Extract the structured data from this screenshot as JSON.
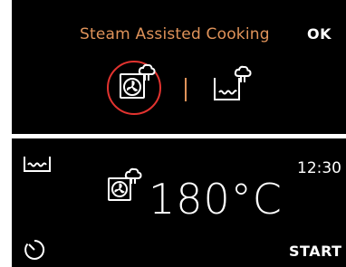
{
  "mode_selector": {
    "title": "Steam Assisted Cooking",
    "ok_label": "OK",
    "options": [
      {
        "icon": "steam-fan-icon",
        "selected": true
      },
      {
        "icon": "steam-bottom-heat-icon",
        "selected": false
      }
    ]
  },
  "status_screen": {
    "mode_icon": "tray-heat-icon",
    "time": "12:30",
    "function_icon": "steam-fan-icon",
    "temperature": "180°C",
    "timer_icon": "timer-icon",
    "start_label": "START"
  },
  "colors": {
    "accent": "#e0935a",
    "selection_ring": "#e2332f",
    "background": "#000000",
    "text": "#ffffff"
  }
}
